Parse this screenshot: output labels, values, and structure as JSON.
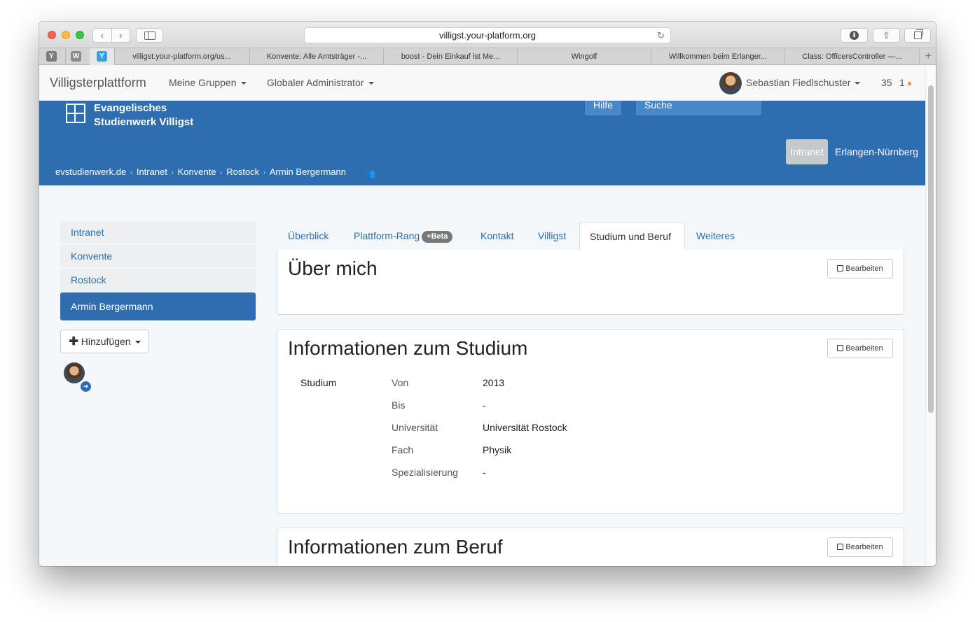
{
  "browser": {
    "nav_back": "‹",
    "nav_forward": "›",
    "url": "villigst.your-platform.org",
    "reload_icon": "↻",
    "download_icon": "⬇",
    "share_icon": "⇪",
    "pinned_tabs": [
      "Y",
      "W",
      "Y"
    ],
    "tabs": [
      "villigst.your-platform.org/us...",
      "Konvente: Alle Amtsträger -...",
      "boost - Dein Einkauf ist Me...",
      "Wingolf",
      "Willkommen beim Erlanger...",
      "Class: OfficersController —..."
    ],
    "new_tab": "+"
  },
  "navbar": {
    "brand": "Villigsterplattform",
    "menu_groups": "Meine Gruppen",
    "menu_admin": "Globaler Administrator",
    "user_name": "Sebastian Fiedlschuster",
    "counter_left": "35",
    "counter_right": "1"
  },
  "header": {
    "logo_line1": "Evangelisches",
    "logo_line2": "Studienwerk Villigst",
    "help": "Hilfe",
    "search": "Suche",
    "pill_active": "Intranet",
    "pill_other": "Erlangen-Nürnberg",
    "breadcrumbs": [
      "evstudienwerk.de",
      "Intranet",
      "Konvente",
      "Rostock",
      "Armin Bergermann"
    ],
    "crumb_sep": "›",
    "crumb_icon": "👥"
  },
  "sidebar": {
    "items": [
      "Intranet",
      "Konvente",
      "Rostock",
      "Armin Bergermann"
    ],
    "add_icon": "✚",
    "add_label": "Hinzufügen",
    "avatar_arrow": "➜"
  },
  "tabs": {
    "overview": "Überblick",
    "rank": "Plattform-Rang",
    "rank_badge": "+Beta",
    "contact": "Kontakt",
    "villigst": "Villigst",
    "studies": "Studium und Beruf",
    "more": "Weiteres"
  },
  "panels": {
    "edit_label": "Bearbeiten",
    "about_title": "Über mich",
    "study_title": "Informationen zum Studium",
    "job_title": "Informationen zum Beruf"
  },
  "study": {
    "section": "Studium",
    "rows": [
      {
        "label": "Von",
        "value": "2013"
      },
      {
        "label": "Bis",
        "value": "-"
      },
      {
        "label": "Universität",
        "value": "Universität Rostock"
      },
      {
        "label": "Fach",
        "value": "Physik"
      },
      {
        "label": "Spezialisierung",
        "value": "-"
      }
    ]
  },
  "colors": {
    "brand_blue": "#2e6eb0",
    "link_blue": "#2a6cad",
    "counter_dot": "#e68a3a"
  }
}
